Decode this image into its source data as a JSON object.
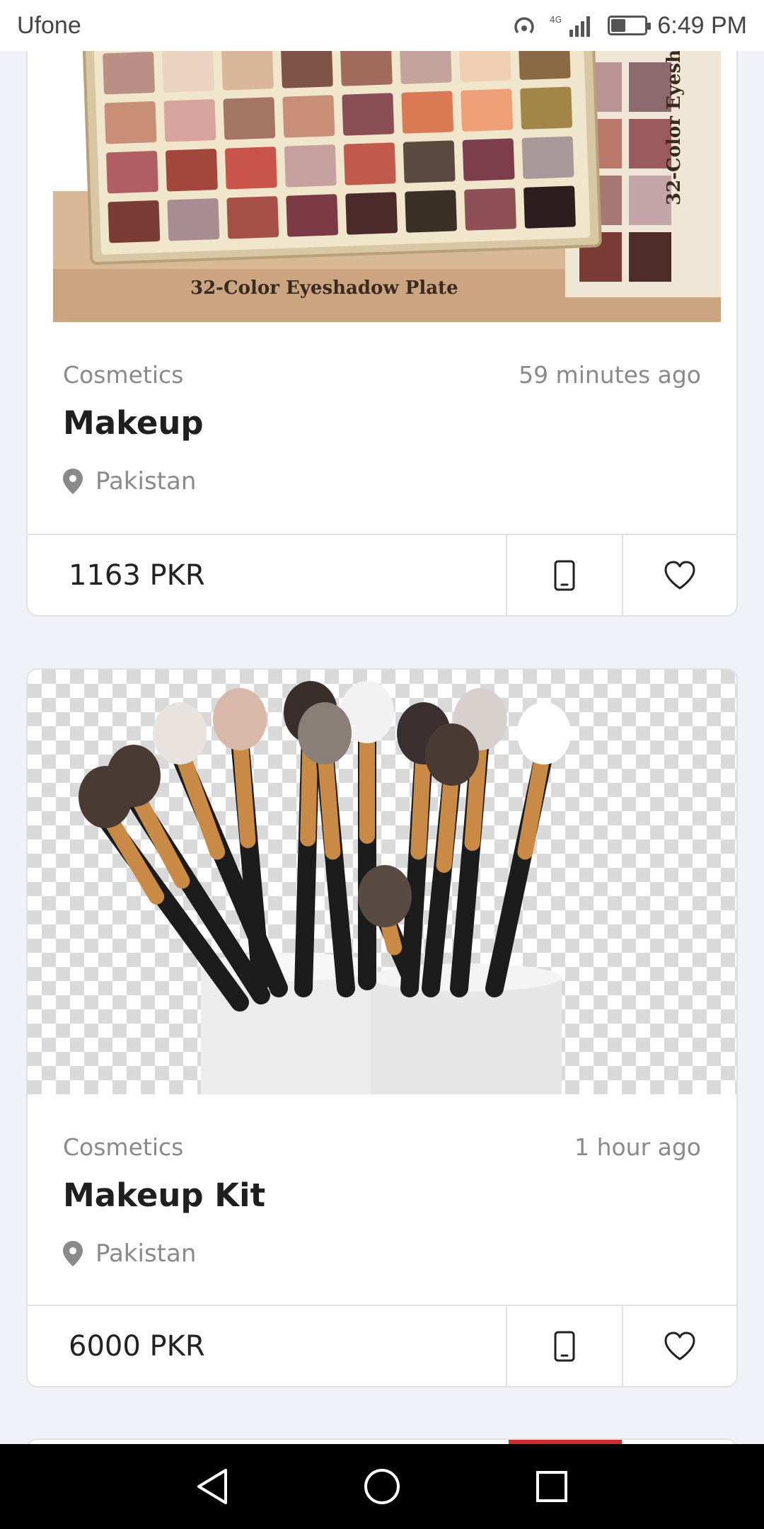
{
  "status_bar": {
    "carrier": "Ufone",
    "network": "4G",
    "time": "6:49 PM",
    "battery_level": 0.4
  },
  "listings": [
    {
      "category": "Cosmetics",
      "time_ago": "59 minutes ago",
      "title": "Makeup",
      "location": "Pakistan",
      "price": "1163 PKR",
      "image": {
        "palette_label_top": "32-Color Eyeshadow Plate",
        "palette_label_side": "32-Color Eyesh"
      }
    },
    {
      "category": "Cosmetics",
      "time_ago": "1 hour ago",
      "title": "Makeup Kit",
      "location": "Pakistan",
      "price": "6000 PKR"
    }
  ],
  "icons": {
    "location": "map-pin-icon",
    "call": "phone-icon",
    "favorite": "heart-icon",
    "back": "back-triangle-icon",
    "home": "home-circle-icon",
    "recents": "recents-square-icon"
  },
  "colors": {
    "background": "#f1f2f7",
    "card": "#ffffff",
    "border": "#dfe1e7",
    "muted_text": "#8a8a8a",
    "title_text": "#1f1f1f"
  }
}
